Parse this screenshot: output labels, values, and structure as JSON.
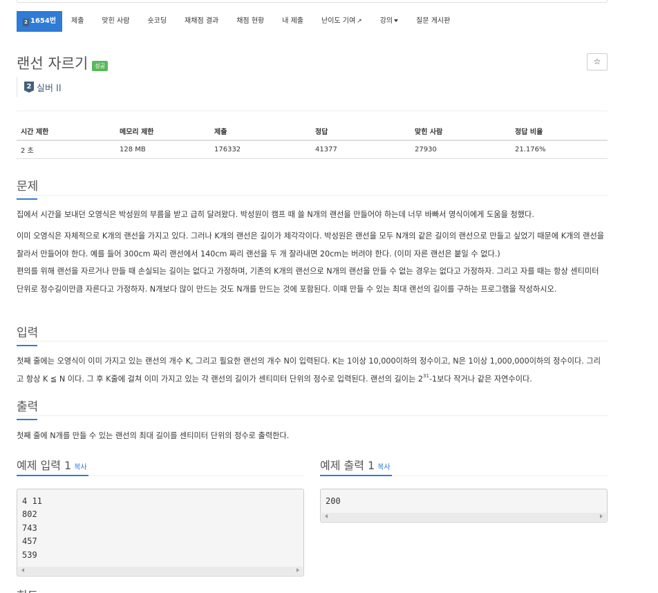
{
  "nav": {
    "problem_number": "1654번",
    "items": [
      "제출",
      "맞힌 사람",
      "숏코딩",
      "재채점 결과",
      "채점 현황",
      "내 제출",
      "난이도 기여",
      "강의"
    ],
    "last": "질문 게시판",
    "tier_num": "2"
  },
  "problem": {
    "title": "랜선 자르기",
    "status": "성공",
    "star": "☆",
    "tier_num": "2",
    "tier": "실버 II"
  },
  "info": {
    "headers": [
      "시간 제한",
      "메모리 제한",
      "제출",
      "정답",
      "맞힌 사람",
      "정답 비율"
    ],
    "values": [
      "2 초",
      "128 MB",
      "176332",
      "41377",
      "27930",
      "21.176%"
    ]
  },
  "sections": {
    "description_title": "문제",
    "description": [
      "집에서 시간을 보내던 오영식은 박성원의 부름을 받고 급히 달려왔다. 박성원이 캠프 때 쓸 N개의 랜선을 만들어야 하는데 너무 바빠서 영식이에게 도움을 청했다.",
      "이미 오영식은 자체적으로 K개의 랜선을 가지고 있다. 그러나 K개의 랜선은 길이가 제각각이다. 박성원은 랜선을 모두 N개의 같은 길이의 랜선으로 만들고 싶었기 때문에 K개의 랜선을 잘라서 만들어야 한다. 예를 들어 300cm 짜리 랜선에서 140cm 짜리 랜선을 두 개 잘라내면 20cm는 버려야 한다. (이미 자른 랜선은 붙일 수 없다.)",
      "편의를 위해 랜선을 자르거나 만들 때 손실되는 길이는 없다고 가정하며, 기존의 K개의 랜선으로 N개의 랜선을 만들 수 없는 경우는 없다고 가정하자. 그리고 자를 때는 항상 센티미터 단위로 정수길이만큼 자른다고 가정하자. N개보다 많이 만드는 것도 N개를 만드는 것에 포함된다. 이때 만들 수 있는 최대 랜선의 길이를 구하는 프로그램을 작성하시오."
    ],
    "input_title": "입력",
    "input_pre": "첫째 줄에는 오영식이 이미 가지고 있는 랜선의 개수 K, 그리고 필요한 랜선의 개수 N이 입력된다. K는 1이상 10,000이하의 정수이고, N은 1이상 1,000,000이하의 정수이다. 그리고 항상 K ≦ N 이다. 그 후 K줄에 걸쳐 이미 가지고 있는 각 랜선의 길이가 센티미터 단위의 정수로 입력된다. 랜선의 길이는 2",
    "input_sup": "31",
    "input_post": "-1보다 작거나 같은 자연수이다.",
    "output_title": "출력",
    "output": "첫째 줄에 N개를 만들 수 있는 랜선의 최대 길이를 센티미터 단위의 정수로 출력한다.",
    "hint_title": "힌트"
  },
  "examples": {
    "input_title": "예제 입력 1",
    "output_title": "예제 출력 1",
    "copy": "복사",
    "input_lines": [
      "4 11",
      "802",
      "743",
      "457",
      "539"
    ],
    "output_lines": [
      "200"
    ]
  }
}
